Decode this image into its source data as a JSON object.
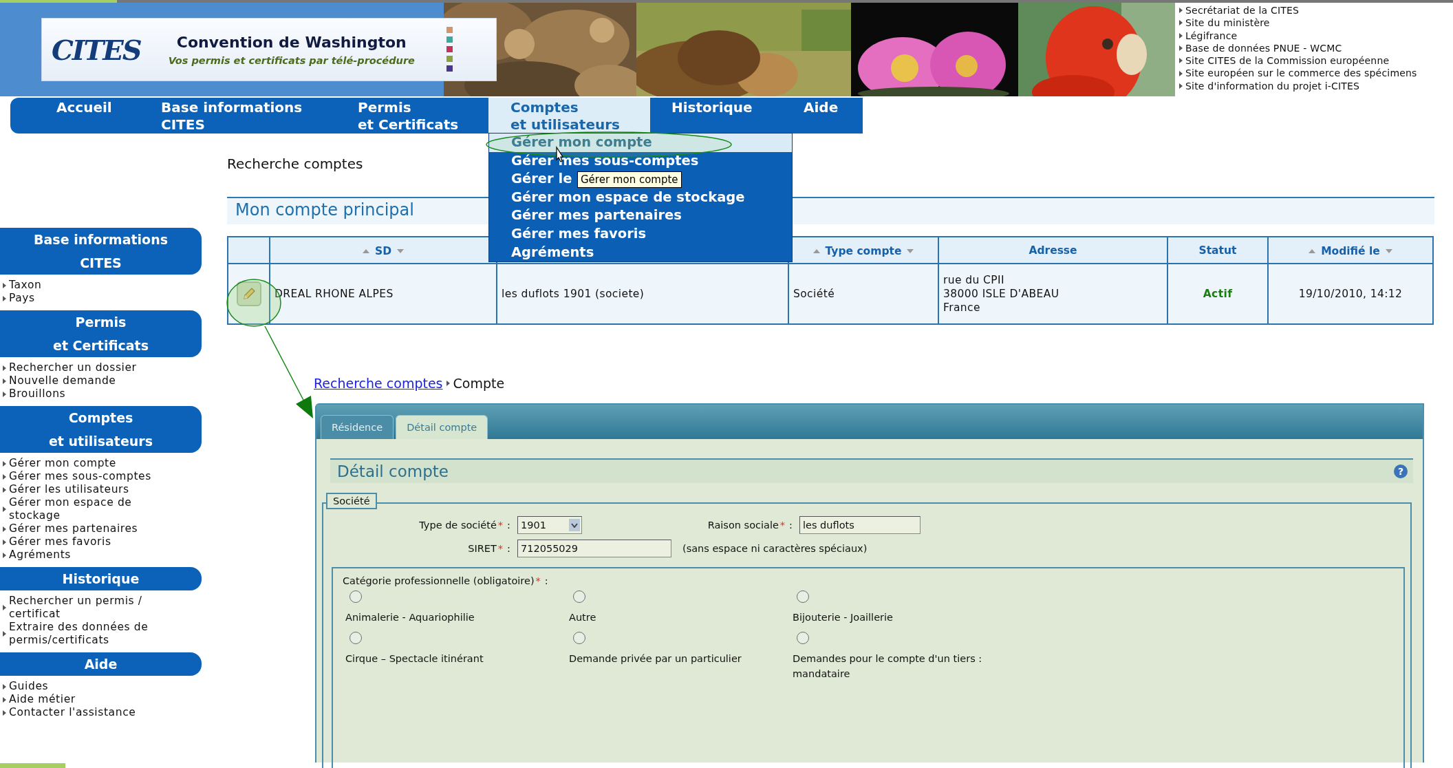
{
  "banner": {
    "logo": "CITES",
    "title": "Convention de Washington",
    "subtitle": "Vos permis et certificats par télé-procédure"
  },
  "links": [
    "Secrétariat de la CITES",
    "Site du ministère",
    "Légifrance",
    "Base de données PNUE - WCMC",
    "Site CITES de la Commission européenne",
    "Site européen sur le commerce des spécimens",
    "Site d'information du projet i-CITES"
  ],
  "nav": [
    {
      "label": "Accueil",
      "selected": false
    },
    {
      "label": "Base informations\nCITES",
      "selected": false
    },
    {
      "label": "Permis\net Certificats",
      "selected": false
    },
    {
      "label": "Comptes\net utilisateurs",
      "selected": true
    },
    {
      "label": "Historique",
      "selected": false
    },
    {
      "label": "Aide",
      "selected": false
    }
  ],
  "dropdown": {
    "items": [
      {
        "label": "Gérer mon compte",
        "selected": true
      },
      {
        "label": "Gérer mes sous-comptes",
        "selected": false
      },
      {
        "label": "Gérer le",
        "selected": false
      },
      {
        "label": "Gérer mon espace de stockage",
        "selected": false
      },
      {
        "label": "Gérer mes partenaires",
        "selected": false
      },
      {
        "label": "Gérer mes favoris",
        "selected": false
      },
      {
        "label": "Agréments",
        "selected": false
      }
    ],
    "tooltip": "Gérer mon compte"
  },
  "sidebar": [
    {
      "title": "Base informations\nCITES",
      "items": [
        "Taxon",
        "Pays"
      ]
    },
    {
      "title": "Permis\net Certificats",
      "items": [
        "Rechercher un dossier",
        "Nouvelle demande",
        "Brouillons"
      ]
    },
    {
      "title": "Comptes\net utilisateurs",
      "items": [
        "Gérer mon compte",
        "Gérer mes sous-comptes",
        "Gérer les utilisateurs",
        "Gérer mon espace de stockage",
        "Gérer mes partenaires",
        "Gérer mes favoris",
        "Agréments"
      ]
    },
    {
      "title": "Historique",
      "items": [
        "Rechercher un permis / certificat",
        "Extraire des données de permis/certificats"
      ]
    },
    {
      "title": "Aide",
      "items": [
        "Guides",
        "Aide métier",
        "Contacter l'assistance"
      ]
    }
  ],
  "page_title": "Recherche comptes",
  "section_title": "Mon compte principal",
  "table": {
    "columns": [
      {
        "kind": "action",
        "sortable": false
      },
      {
        "kind": "text",
        "label": "SD",
        "sortable": true
      },
      {
        "kind": "text",
        "sortable": false
      },
      {
        "kind": "text",
        "label": "Type compte",
        "sortable": true
      },
      {
        "kind": "text",
        "label": "Adresse",
        "sortable": false
      },
      {
        "kind": "status",
        "label": "Statut",
        "sortable": false
      },
      {
        "kind": "text",
        "label": "Modifié le",
        "sortable": true
      }
    ],
    "rows": [
      {
        "cells": [
          "",
          "DREAL RHONE ALPES",
          "les duflots 1901 (societe)",
          "Société",
          "rue du CPII\n38000 ISLE D'ABEAU\nFrance",
          "Actif",
          "19/10/2010, 14:12"
        ]
      }
    ]
  },
  "breadcrumb": {
    "link": "Recherche comptes",
    "current": "Compte"
  },
  "panel": {
    "tabs": [
      {
        "label": "Résidence",
        "selected": false
      },
      {
        "label": "Détail compte",
        "selected": true
      }
    ],
    "title": "Détail compte",
    "help": "?",
    "legend": "Société",
    "required_mark": "*",
    "separator": ":",
    "fields": [
      {
        "kind": "select",
        "label": "Type de société",
        "required": true,
        "value": "1901"
      },
      {
        "kind": "text",
        "label": "Raison sociale",
        "required": true,
        "value": "les duflots"
      },
      {
        "kind": "text",
        "label": "SIRET",
        "required": true,
        "value": "712055029",
        "hint": "(sans espace ni caractères spéciaux)"
      }
    ],
    "category": {
      "label": "Catégorie professionnelle (obligatoire)",
      "required": true,
      "options": [
        {
          "label": "Animalerie - Aquariophilie",
          "selected": false
        },
        {
          "label": "Autre",
          "selected": false
        },
        {
          "label": "Bijouterie - Joaillerie",
          "selected": false
        },
        {
          "label": "Cirque – Spectacle itinérant",
          "selected": false
        },
        {
          "label": "Demande privée par un particulier",
          "selected": false
        },
        {
          "label": "Demandes pour le compte d'un tiers : mandataire",
          "selected": false
        }
      ]
    }
  }
}
